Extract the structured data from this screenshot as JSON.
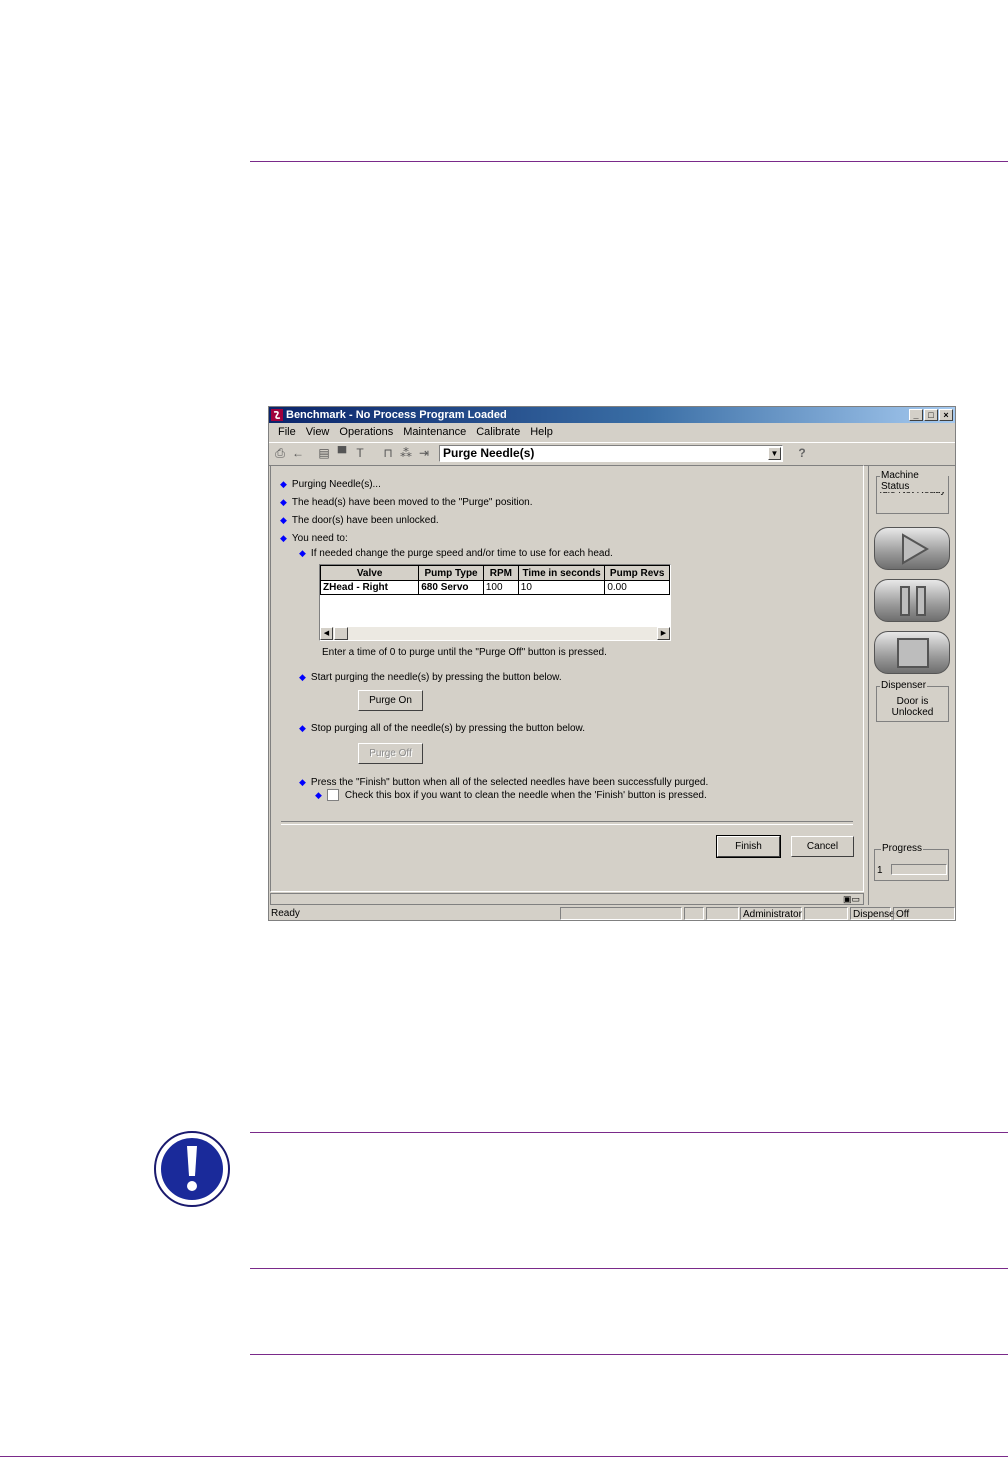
{
  "window": {
    "title": "Benchmark - No Process Program Loaded",
    "buttons": [
      "_",
      "□",
      "×"
    ]
  },
  "menu": [
    "File",
    "View",
    "Operations",
    "Maintenance",
    "Calibrate",
    "Help"
  ],
  "toolbar": {
    "combo_value": "Purge Needle(s)",
    "help_label": "?"
  },
  "steps": {
    "s1": "Purging Needle(s)...",
    "s2": "The head(s) have been moved to the \"Purge\" position.",
    "s3": "The door(s) have been unlocked.",
    "s4": "You need to:",
    "s5": "If needed change the purge speed and/or time to use for each head.",
    "note_zero": "Enter a time of 0 to purge until the \"Purge Off\" button is pressed.",
    "s6": "Start purging the needle(s) by pressing the button below.",
    "s7": "Stop purging all of the needle(s) by pressing the button below.",
    "s8": "Press the \"Finish\" button when all of the selected needles have been successfully purged.",
    "s9": "Check this box if you want to clean the needle when the 'Finish' button is pressed."
  },
  "grid": {
    "headers": [
      "Valve",
      "Pump Type",
      "RPM",
      "Time in seconds",
      "Pump Revs"
    ],
    "row": [
      "ZHead - Right",
      "680 Servo",
      "100",
      "10",
      "0.00"
    ]
  },
  "buttons": {
    "purge_on": "Purge On",
    "purge_off": "Purge Off",
    "finish": "Finish",
    "cancel": "Cancel"
  },
  "side": {
    "status_legend": "Machine Status",
    "status_text": "Idle Not Ready",
    "dispenser_legend": "Dispenser",
    "dispenser_text": "Door is Unlocked",
    "progress_legend": "Progress",
    "progress_value": "1"
  },
  "statusbar": {
    "ready": "Ready",
    "user": "Administrator",
    "mode": "Dispense",
    "state": "Off"
  }
}
